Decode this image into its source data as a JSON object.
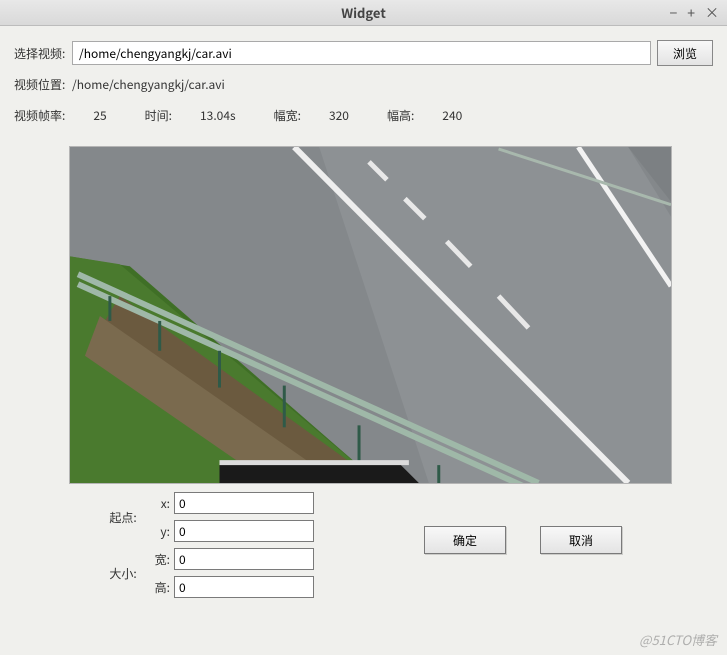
{
  "window": {
    "title": "Widget"
  },
  "form": {
    "select_video_label": "选择视频:",
    "video_path_value": "/home/chengyangkj/car.avi",
    "browse_label": "浏览",
    "video_location_label": "视频位置:",
    "video_location_value": "/home/chengyangkj/car.avi"
  },
  "info": {
    "fps_label": "视频帧率:",
    "fps_value": "25",
    "time_label": "时间:",
    "time_value": "13.04s",
    "width_label": "幅宽:",
    "width_value": "320",
    "height_label": "幅高:",
    "height_value": "240"
  },
  "roi": {
    "origin_label": "起点:",
    "size_label": "大小:",
    "x_label": "x:",
    "y_label": "y:",
    "w_label": "宽:",
    "h_label": "高:",
    "x_value": "0",
    "y_value": "0",
    "w_value": "0",
    "h_value": "0"
  },
  "actions": {
    "ok_label": "确定",
    "cancel_label": "取消"
  },
  "watermark": "@51CTO博客"
}
